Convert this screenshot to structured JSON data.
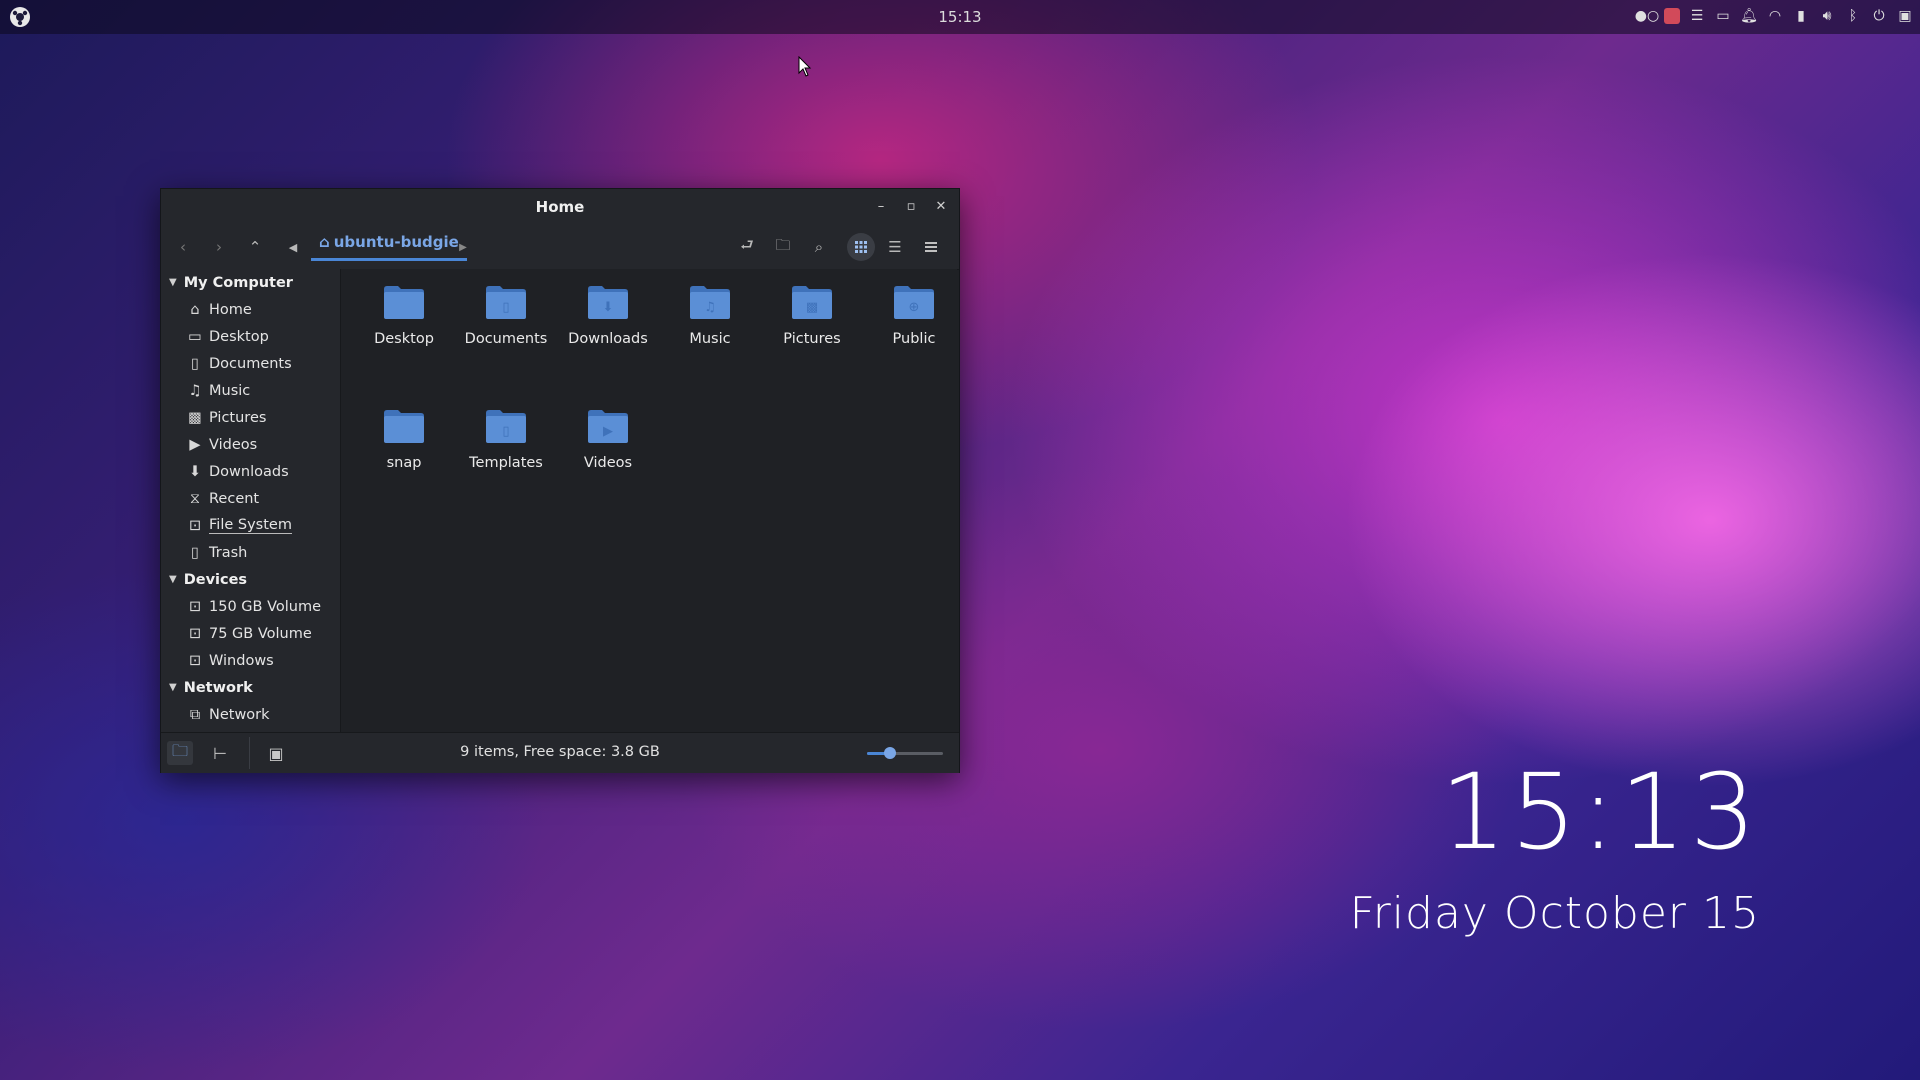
{
  "panel": {
    "clock": "15:13"
  },
  "desktop_clock": {
    "time": "15:13",
    "date": "Friday October 15"
  },
  "window": {
    "title": "Home",
    "breadcrumb": {
      "current": "ubuntu-budgie"
    },
    "sidebar": {
      "sections": [
        {
          "label": "My Computer",
          "items": [
            {
              "label": "Home",
              "icon": "home-icon"
            },
            {
              "label": "Desktop",
              "icon": "desktop-icon"
            },
            {
              "label": "Documents",
              "icon": "document-icon"
            },
            {
              "label": "Music",
              "icon": "music-icon"
            },
            {
              "label": "Pictures",
              "icon": "pictures-icon"
            },
            {
              "label": "Videos",
              "icon": "video-icon"
            },
            {
              "label": "Downloads",
              "icon": "download-icon"
            },
            {
              "label": "Recent",
              "icon": "recent-icon"
            },
            {
              "label": "File System",
              "icon": "drive-icon"
            },
            {
              "label": "Trash",
              "icon": "trash-icon"
            }
          ]
        },
        {
          "label": "Devices",
          "items": [
            {
              "label": "150 GB Volume",
              "icon": "drive-icon"
            },
            {
              "label": "75 GB Volume",
              "icon": "drive-icon"
            },
            {
              "label": "Windows",
              "icon": "drive-icon"
            }
          ]
        },
        {
          "label": "Network",
          "items": [
            {
              "label": "Network",
              "icon": "network-icon"
            }
          ]
        }
      ]
    },
    "files": [
      {
        "name": "Desktop",
        "emblem": "none"
      },
      {
        "name": "Documents",
        "emblem": "document"
      },
      {
        "name": "Downloads",
        "emblem": "download"
      },
      {
        "name": "Music",
        "emblem": "music"
      },
      {
        "name": "Pictures",
        "emblem": "picture"
      },
      {
        "name": "Public",
        "emblem": "public"
      },
      {
        "name": "snap",
        "emblem": "none"
      },
      {
        "name": "Templates",
        "emblem": "document"
      },
      {
        "name": "Videos",
        "emblem": "video"
      }
    ],
    "status": {
      "text": "9 items, Free space: 3.8 GB",
      "zoom_level": 0.3
    }
  },
  "colors": {
    "accent": "#4a86d6",
    "folder": "#5b8fd6",
    "folder_dark": "#3f72ba"
  }
}
